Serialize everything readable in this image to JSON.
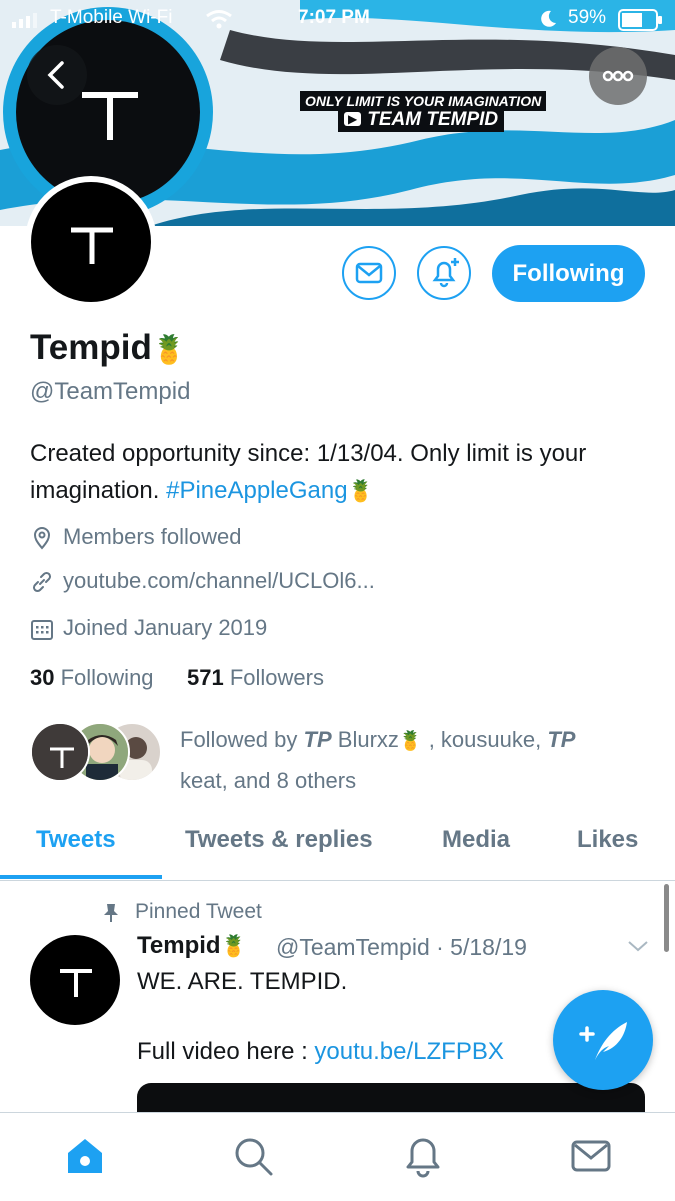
{
  "status_bar": {
    "carrier": "T-Mobile Wi-Fi",
    "time": "7:07 PM",
    "battery": "59%"
  },
  "banner": {
    "tagline": "ONLY LIMIT IS YOUR IMAGINATION",
    "team": "TEAM TEMPID",
    "logo_letter": "T"
  },
  "profile": {
    "name": "Tempid",
    "emoji": "🍍",
    "handle": "@TeamTempid",
    "bio_text": "Created opportunity since: 1/13/04. Only limit is your imagination.",
    "bio_hashtag": "#PineAppleGang",
    "location": "Members followed",
    "website": "youtube.com/channel/UCLOl6...",
    "joined": "Joined January 2019",
    "following_count": "30",
    "following_label": "Following",
    "followers_count": "571",
    "followers_label": "Followers",
    "followed_by_prefix": "Followed by",
    "followed_by_tp1": "TP",
    "followed_by_name1": "Blurxz",
    "followed_by_name2": ", kousuuke,",
    "followed_by_tp2": "TP",
    "followed_by_rest": "keat, and 8 others"
  },
  "actions": {
    "follow_label": "Following"
  },
  "tabs": [
    {
      "label": "Tweets"
    },
    {
      "label": "Tweets & replies"
    },
    {
      "label": "Media"
    },
    {
      "label": "Likes"
    }
  ],
  "tweet": {
    "pinned_label": "Pinned Tweet",
    "author_name": "Tempid",
    "author_handle": "@TeamTempid · 5/18/19",
    "line1": "WE. ARE. TEMPID.",
    "line2_prefix": "Full video here : ",
    "line2_link": "youtu.be/LZFPBX"
  },
  "colors": {
    "accent": "#1da1f2",
    "link": "#1b95e0",
    "muted": "#657786",
    "text": "#14171a"
  },
  "icons": {
    "bottom_nav": [
      "home-icon",
      "search-icon",
      "notifications-icon",
      "messages-icon"
    ]
  }
}
